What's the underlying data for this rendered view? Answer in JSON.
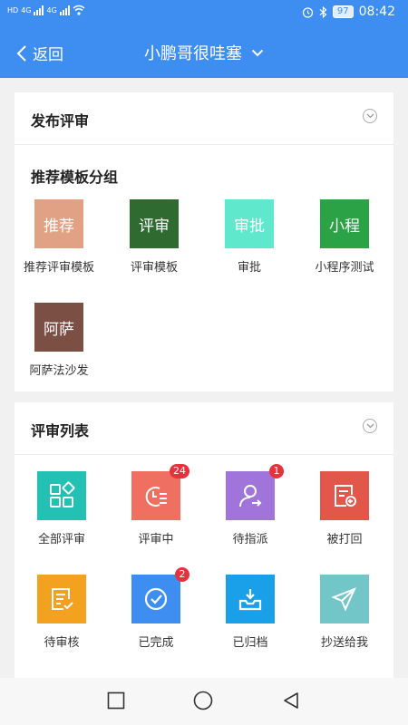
{
  "status_bar": {
    "left_tags": [
      "HD",
      "4G",
      "4G",
      "HD"
    ],
    "battery": "97",
    "time": "08:42"
  },
  "nav": {
    "back_label": "返回",
    "title": "小鹏哥很哇塞"
  },
  "publish_section": {
    "title": "发布评审",
    "group_title": "推荐模板分组",
    "items": [
      {
        "icon_text": "推荐",
        "label": "推荐评审模板",
        "color": "#e1a184"
      },
      {
        "icon_text": "评审",
        "label": "评审模板",
        "color": "#2f6a31"
      },
      {
        "icon_text": "审批",
        "label": "审批",
        "color": "#5fe8cb"
      },
      {
        "icon_text": "小程",
        "label": "小程序测试",
        "color": "#2ba246"
      },
      {
        "icon_text": "阿萨",
        "label": "阿萨法沙发",
        "color": "#7c4f44"
      }
    ]
  },
  "review_section": {
    "title": "评审列表",
    "items": [
      {
        "label": "全部评审",
        "icon": "grid-icon",
        "color": "#22c1b3",
        "badge": ""
      },
      {
        "label": "评审中",
        "icon": "clock-list-icon",
        "color": "#ef7061",
        "badge": "24"
      },
      {
        "label": "待指派",
        "icon": "person-assign-icon",
        "color": "#a074db",
        "badge": "1"
      },
      {
        "label": "被打回",
        "icon": "doc-return-icon",
        "color": "#e2574a",
        "badge": ""
      },
      {
        "label": "待审核",
        "icon": "doc-check-icon",
        "color": "#f3a21f",
        "badge": ""
      },
      {
        "label": "已完成",
        "icon": "check-circle-icon",
        "color": "#3d8ef0",
        "badge": "2"
      },
      {
        "label": "已归档",
        "icon": "archive-icon",
        "color": "#1aa0e8",
        "badge": ""
      },
      {
        "label": "抄送给我",
        "icon": "paper-plane-icon",
        "color": "#72c6c8",
        "badge": ""
      }
    ]
  }
}
